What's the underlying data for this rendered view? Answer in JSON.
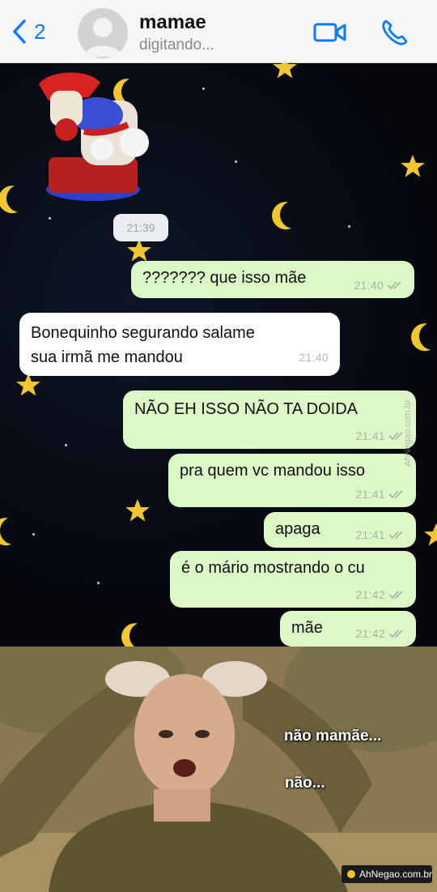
{
  "header": {
    "back_count": "2",
    "contact_name": "mamae",
    "status": "digitando..."
  },
  "chat": {
    "sticker_time": "21:39",
    "messages": [
      {
        "direction": "out",
        "text": "??????? que isso mãe",
        "time": "21:40"
      },
      {
        "direction": "in",
        "text_lines": [
          "Bonequinho segurando salame",
          "sua irmã me mandou"
        ],
        "time": "21:40"
      },
      {
        "direction": "out",
        "text": "NÃO EH ISSO NÃO TA DOIDA",
        "time": "21:41"
      },
      {
        "direction": "out",
        "text": "pra quem vc mandou isso",
        "time": "21:41"
      },
      {
        "direction": "out",
        "text": "apaga",
        "time": "21:41"
      },
      {
        "direction": "out",
        "text": "é o mário mostrando o cu",
        "time": "21:42"
      },
      {
        "direction": "out",
        "text": "mãe",
        "time": "21:42"
      }
    ],
    "side_watermark": "AhNegao.com.br"
  },
  "meme": {
    "caption_1": "não mamãe...",
    "caption_2": "não...",
    "badge": "AhNegao.com.br"
  },
  "colors": {
    "accent": "#0a7cff",
    "out_bubble": "#dcf8c6",
    "in_bubble": "#ffffff",
    "moon_star": "#f2c62f"
  }
}
